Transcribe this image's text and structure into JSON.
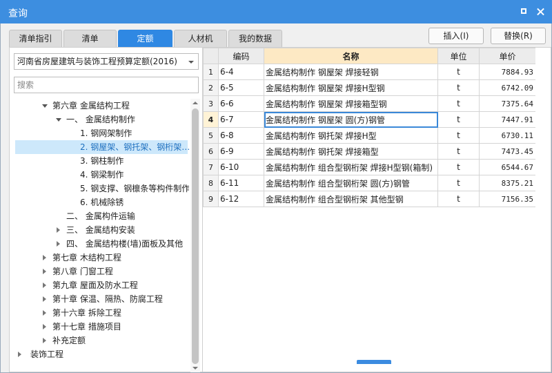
{
  "window": {
    "title": "查询"
  },
  "tabs": [
    {
      "label": "清单指引",
      "active": false
    },
    {
      "label": "清单",
      "active": false
    },
    {
      "label": "定额",
      "active": true
    },
    {
      "label": "人材机",
      "active": false
    },
    {
      "label": "我的数据",
      "active": false
    }
  ],
  "actions": {
    "insert": "插入(I)",
    "replace": "替换(R)"
  },
  "library": {
    "selected": "河南省房屋建筑与装饰工程预算定额(2016)"
  },
  "search": {
    "placeholder": "搜索"
  },
  "tree": [
    {
      "label": "第六章  金属结构工程",
      "toggle": "expanded",
      "depth": 1
    },
    {
      "label": "一、  金属结构制作",
      "toggle": "expanded",
      "depth": 2
    },
    {
      "label": "1. 钢网架制作",
      "toggle": "none",
      "depth": 3
    },
    {
      "label": "2. 钢屋架、钢托架、钢桁架…",
      "toggle": "none",
      "depth": 3,
      "selected": true
    },
    {
      "label": "3. 钢柱制作",
      "toggle": "none",
      "depth": 3
    },
    {
      "label": "4. 钢梁制作",
      "toggle": "none",
      "depth": 3
    },
    {
      "label": "5. 钢支撑、钢檩条等构件制作",
      "toggle": "none",
      "depth": 3
    },
    {
      "label": "6. 机械除锈",
      "toggle": "none",
      "depth": 3
    },
    {
      "label": "二、  金属构件运输",
      "toggle": "none",
      "depth": 2
    },
    {
      "label": "三、  金属结构安装",
      "toggle": "collapsed",
      "depth": 2
    },
    {
      "label": "四、  金属结构楼(墙)面板及其他",
      "toggle": "collapsed",
      "depth": 2
    },
    {
      "label": "第七章  木结构工程",
      "toggle": "collapsed",
      "depth": 1
    },
    {
      "label": "第八章  门窗工程",
      "toggle": "collapsed",
      "depth": 1
    },
    {
      "label": "第九章  屋面及防水工程",
      "toggle": "collapsed",
      "depth": 1
    },
    {
      "label": "第十章  保温、隔热、防腐工程",
      "toggle": "collapsed",
      "depth": 1
    },
    {
      "label": "第十六章  拆除工程",
      "toggle": "collapsed",
      "depth": 1
    },
    {
      "label": "第十七章  措施项目",
      "toggle": "collapsed",
      "depth": 1
    },
    {
      "label": "补充定额",
      "toggle": "collapsed",
      "depth": 1
    },
    {
      "label": "装饰工程",
      "toggle": "collapsed",
      "depth": 0
    }
  ],
  "table": {
    "headers": {
      "code": "编码",
      "name": "名称",
      "unit": "单位",
      "price": "单价"
    },
    "rows": [
      {
        "num": "1",
        "code": "6-4",
        "name": "金属结构制作  钢屋架  焊接轻钢",
        "unit": "t",
        "price": "7884.93"
      },
      {
        "num": "2",
        "code": "6-5",
        "name": "金属结构制作  钢屋架  焊接H型钢",
        "unit": "t",
        "price": "6742.09"
      },
      {
        "num": "3",
        "code": "6-6",
        "name": "金属结构制作  钢屋架  焊接箱型钢",
        "unit": "t",
        "price": "7375.64"
      },
      {
        "num": "4",
        "code": "6-7",
        "name": "金属结构制作  钢屋架  圆(方)钢管",
        "unit": "t",
        "price": "7447.91",
        "current": true
      },
      {
        "num": "5",
        "code": "6-8",
        "name": "金属结构制作  钢托架  焊接H型",
        "unit": "t",
        "price": "6730.11"
      },
      {
        "num": "6",
        "code": "6-9",
        "name": "金属结构制作  钢托架  焊接箱型",
        "unit": "t",
        "price": "7473.45"
      },
      {
        "num": "7",
        "code": "6-10",
        "name": "金属结构制作  组合型钢桁架  焊接H型钢(箱制)",
        "unit": "t",
        "price": "6544.67"
      },
      {
        "num": "8",
        "code": "6-11",
        "name": "金属结构制作  组合型钢桁架  圆(方)钢管",
        "unit": "t",
        "price": "8375.21"
      },
      {
        "num": "9",
        "code": "6-12",
        "name": "金属结构制作  组合型钢桁架  其他型钢",
        "unit": "t",
        "price": "7156.35"
      }
    ]
  },
  "colors": {
    "titlebar": "#3d8ee0",
    "tab_active": "#2f88e3",
    "selected_row": "#cde8fb",
    "header_highlight": "#fde9c4"
  }
}
